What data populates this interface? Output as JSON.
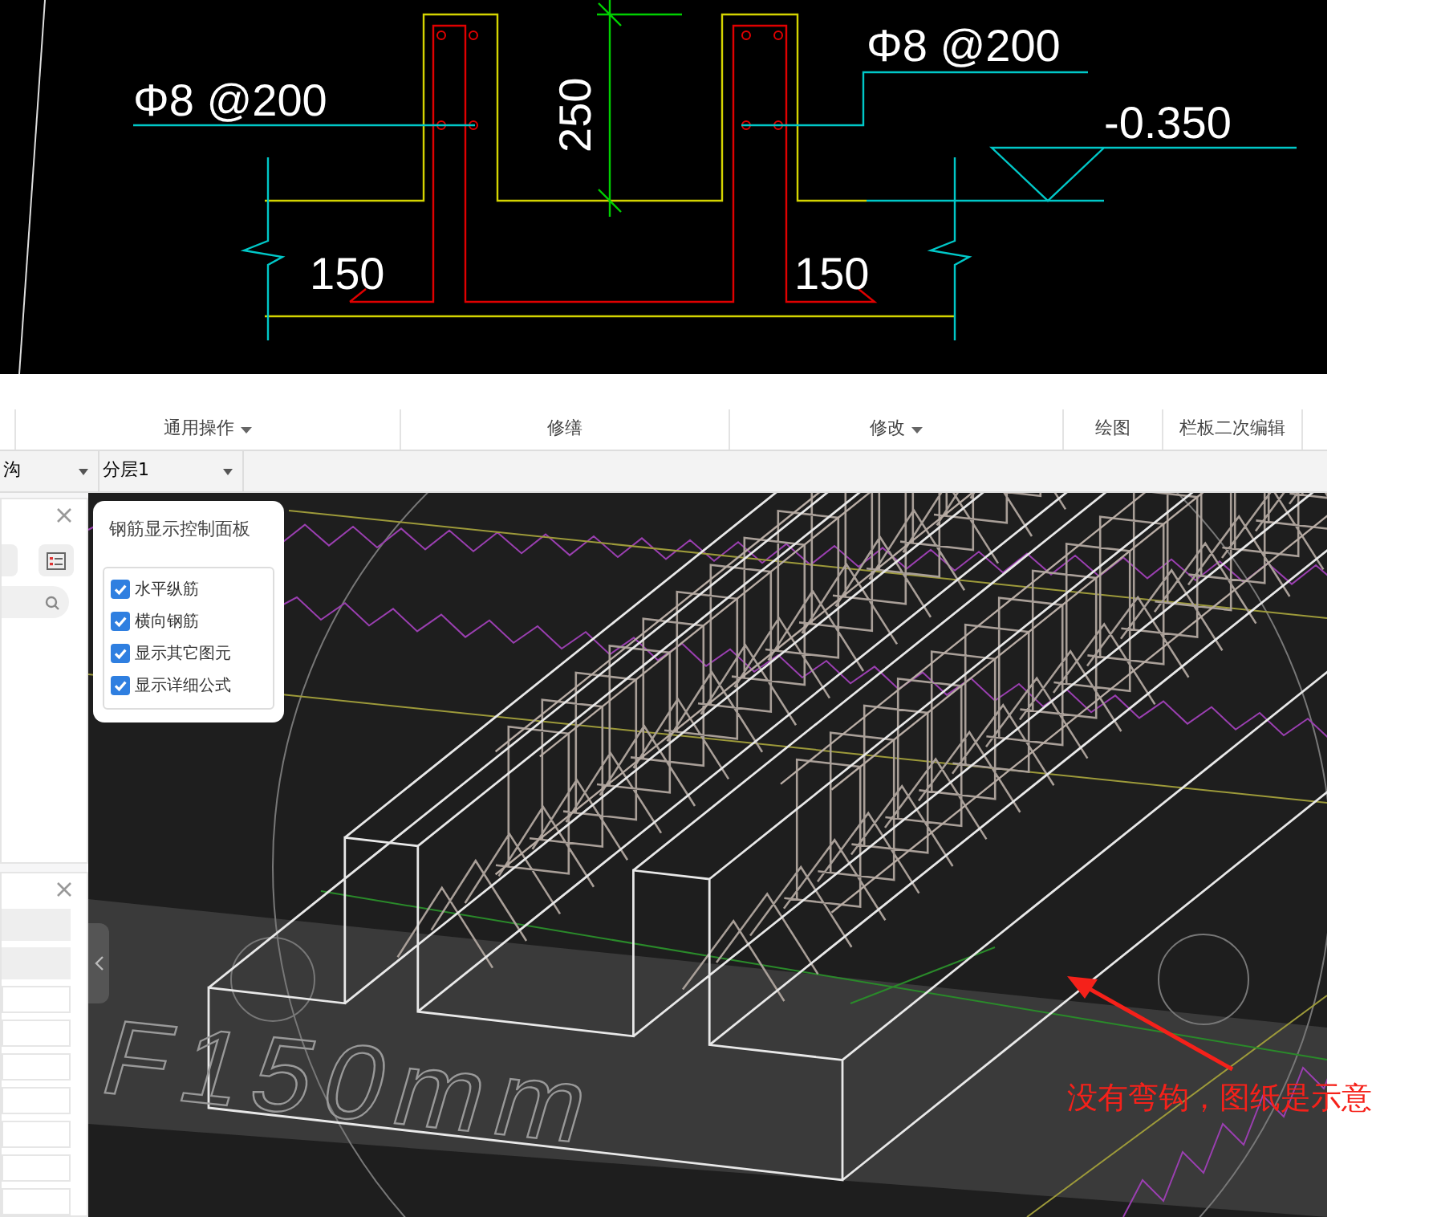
{
  "cad_drawing": {
    "labels": [
      {
        "kind": "rebar",
        "text": "Φ8 @200"
      },
      {
        "kind": "rebar",
        "text": "Φ8 @200"
      },
      {
        "kind": "dimension_vertical",
        "text": "250"
      },
      {
        "kind": "elevation",
        "text": "-0.350"
      },
      {
        "kind": "dimension",
        "text": "150"
      },
      {
        "kind": "dimension",
        "text": "150"
      }
    ]
  },
  "ribbon": {
    "groups": [
      {
        "label": "通用操作",
        "dropdown": true
      },
      {
        "label": "修缮",
        "dropdown": false
      },
      {
        "label": "修改",
        "dropdown": true
      },
      {
        "label": "绘图",
        "dropdown": false
      },
      {
        "label": "栏板二次编辑",
        "dropdown": false
      }
    ]
  },
  "toolbar": {
    "dropdowns": [
      {
        "value": "沟"
      },
      {
        "value": "分层1"
      }
    ]
  },
  "control_panel": {
    "title": "钢筋显示控制面板",
    "options": [
      {
        "label": "水平纵筋",
        "checked": true
      },
      {
        "label": "横向钢筋",
        "checked": true
      },
      {
        "label": "显示其它图元",
        "checked": true
      },
      {
        "label": "显示详细公式",
        "checked": true
      }
    ]
  },
  "viewport": {
    "model_text": "F150mm"
  },
  "annotation": {
    "text": "没有弯钩，图纸是示意"
  }
}
